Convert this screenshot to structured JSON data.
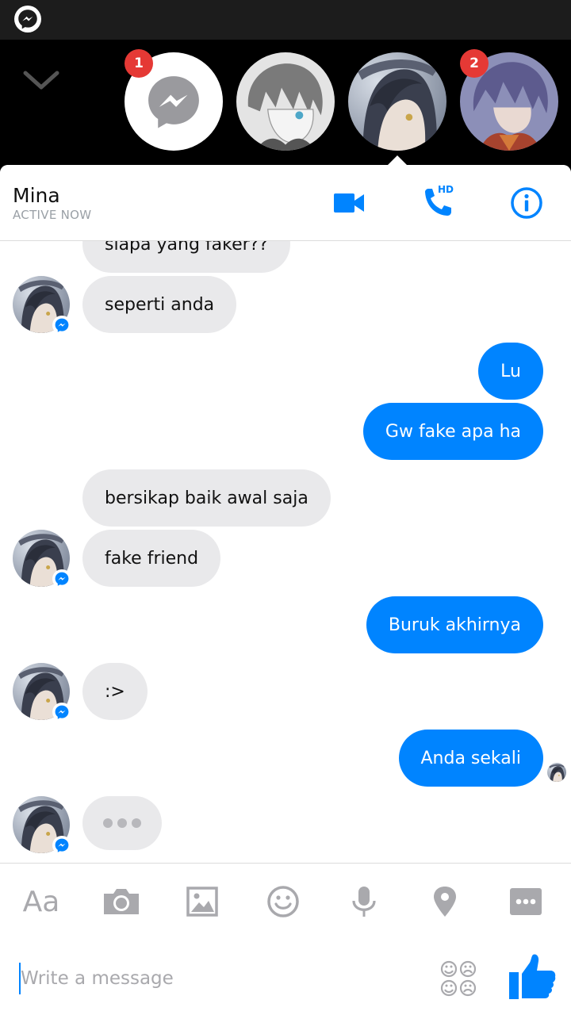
{
  "chat_heads": {
    "badge_messenger": "1",
    "badge_fourth": "2"
  },
  "conversation": {
    "contact_name": "Mina",
    "contact_status": "ACTIVE NOW",
    "hd_label": "HD"
  },
  "messages": [
    {
      "from": "them",
      "text": "siapa yang faker??"
    },
    {
      "from": "them",
      "text": "seperti anda"
    },
    {
      "from": "me",
      "text": "Lu"
    },
    {
      "from": "me",
      "text": "Gw fake apa ha"
    },
    {
      "from": "them",
      "text": "bersikap baik awal saja"
    },
    {
      "from": "them",
      "text": "fake friend"
    },
    {
      "from": "me",
      "text": "Buruk akhirnya"
    },
    {
      "from": "them",
      "text": ":>"
    },
    {
      "from": "me",
      "text": "Anda sekali"
    }
  ],
  "toolbar": {
    "text_format_label": "Aa",
    "icons": [
      "camera-icon",
      "gallery-icon",
      "emoji-icon",
      "microphone-icon",
      "location-icon",
      "more-icon"
    ]
  },
  "composer": {
    "placeholder": "Write a message"
  },
  "colors": {
    "accent": "#0084ff",
    "incoming_bubble": "#e9e9eb",
    "badge": "#e53935",
    "toolbar_icon": "#a9a9ad"
  }
}
